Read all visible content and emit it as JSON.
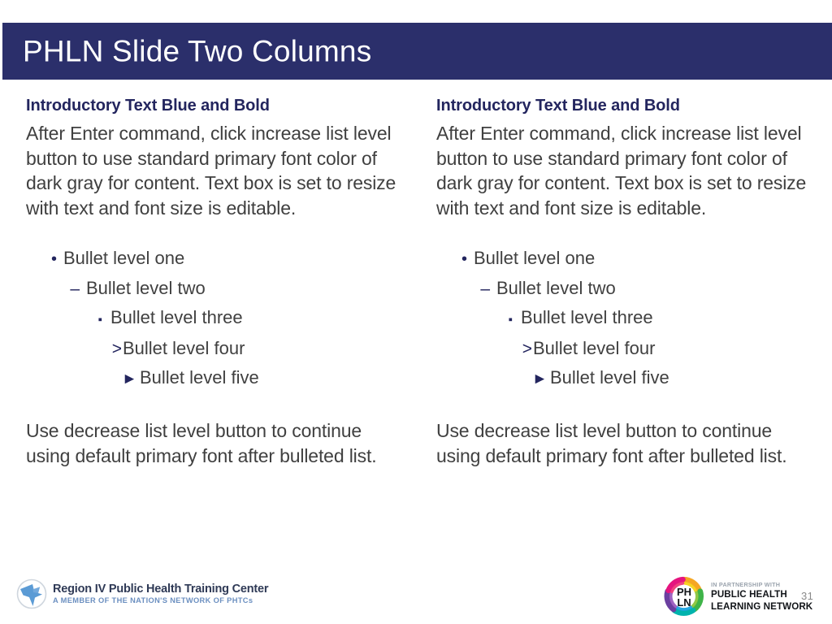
{
  "slide": {
    "title": "PHLN Slide Two Columns",
    "page_number": "31",
    "colors": {
      "title_bar_bg": "#2b2f6b",
      "title_text": "#ffffff",
      "heading_blue": "#23255e",
      "body_gray": "#404040",
      "page_number_gray": "#8a8a8a"
    }
  },
  "columns": [
    {
      "heading": "Introductory Text Blue and Bold",
      "intro": "After Enter command, click increase list level button to use standard primary font color of dark gray for content. Text box is set to resize with text and font size is editable.",
      "bullets": [
        {
          "level": 1,
          "marker": "•",
          "label": "Bullet level one"
        },
        {
          "level": 2,
          "marker": "–",
          "label": "Bullet level two"
        },
        {
          "level": 3,
          "marker": "▪",
          "label": "Bullet level three"
        },
        {
          "level": 4,
          "marker": ">",
          "label": "Bullet level four"
        },
        {
          "level": 5,
          "marker": "►",
          "label": "Bullet level five"
        }
      ],
      "outro": "Use decrease list level button to continue using default primary font after bulleted list."
    },
    {
      "heading": "Introductory Text Blue and Bold",
      "intro": "After Enter command, click increase list level button to use standard primary font color of dark gray for content. Text box is set to resize with text and font size is editable.",
      "bullets": [
        {
          "level": 1,
          "marker": "•",
          "label": "Bullet level one"
        },
        {
          "level": 2,
          "marker": "–",
          "label": "Bullet level two"
        },
        {
          "level": 3,
          "marker": "▪",
          "label": "Bullet level three"
        },
        {
          "level": 4,
          "marker": ">",
          "label": "Bullet level four"
        },
        {
          "level": 5,
          "marker": "►",
          "label": "Bullet level five"
        }
      ],
      "outro": "Use decrease list level button to continue using default primary font after bulleted list."
    }
  ],
  "footer": {
    "region_logo": {
      "icon": "region-map-icon",
      "title": "Region IV Public Health Training Center",
      "subtitle": "A MEMBER OF THE NATION'S NETWORK OF PHTCs",
      "title_color": "#2f3a56",
      "subtitle_color": "#6b8fc0",
      "icon_color": "#5b9bd5"
    },
    "phln_logo": {
      "icon": "phln-pentagon-icon",
      "monogram_line1": "PH",
      "monogram_line2": "LN",
      "partner_label": "IN PARTNERSHIP WITH",
      "name_line1": "PUBLIC HEALTH",
      "name_line2": "LEARNING NETWORK",
      "pentagon_colors": [
        "#e5147f",
        "#f5a623",
        "#f7d117",
        "#3fb449",
        "#00b3ad",
        "#1aa3e0",
        "#6b3fa0"
      ]
    }
  }
}
